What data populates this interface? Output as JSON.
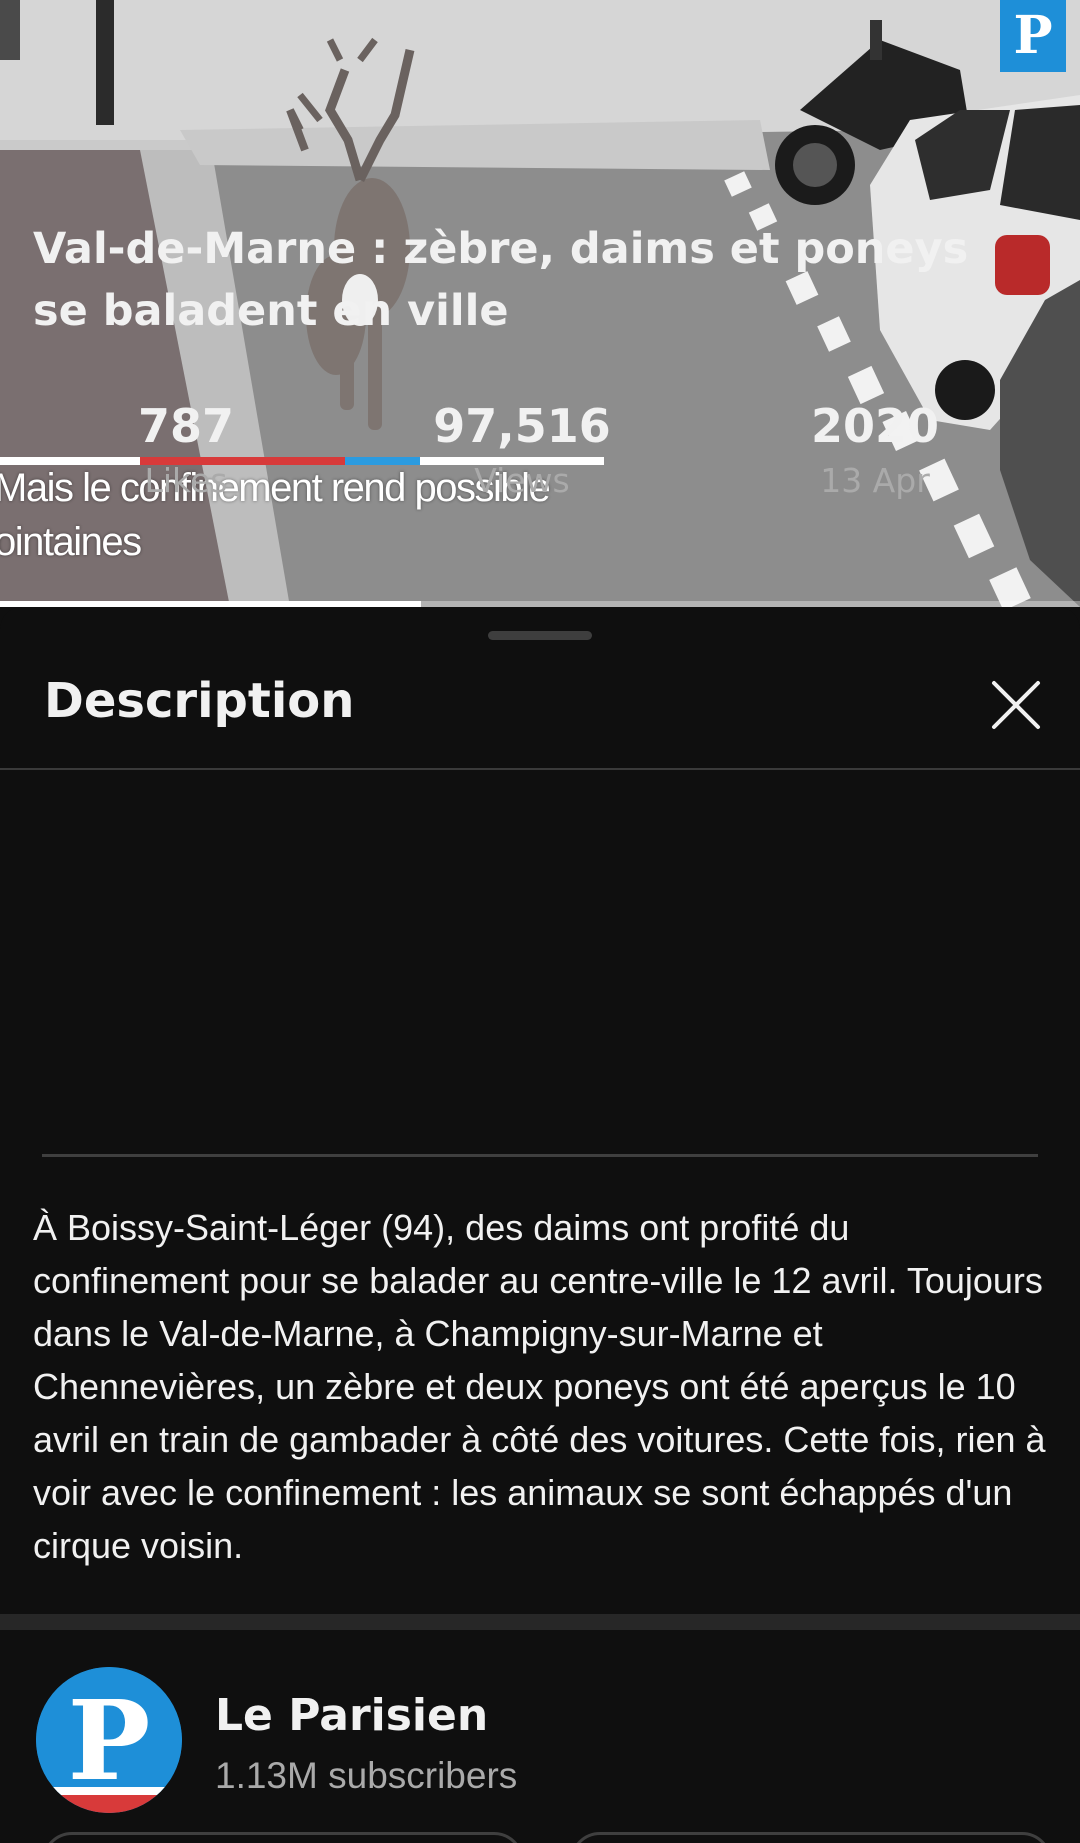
{
  "video": {
    "watermark": "P",
    "subtitle_lines": [
      "Mais le confinement rend possible",
      "ointaines"
    ],
    "progress": 0.39,
    "colors": {
      "bar_white": "#ffffff",
      "bar_red": "#d83a3a",
      "bar_blue": "#2b9be0",
      "logo_blue": "#1e8fd8"
    }
  },
  "sheet": {
    "title": "Description",
    "close_icon": "close-icon"
  },
  "video_info": {
    "title": "Val-de-Marne : zèbre, daims et poneys se baladent en ville",
    "stats": [
      {
        "value": "787",
        "label": "Likes"
      },
      {
        "value": "97,516",
        "label": "Views"
      },
      {
        "value": "2020",
        "label": "13 Apr"
      }
    ],
    "description": "À Boissy-Saint-Léger (94), des daims ont profité du confinement pour se balader au centre-ville le 12 avril. Toujours dans le Val-de-Marne, à Champigny-sur-Marne et Chennevières, un zèbre et deux poneys ont été aperçus le 10 avril en train de gambader à côté des voitures. Cette fois, rien à voir avec le confinement : les animaux se sont échappés d'un cirque voisin."
  },
  "channel": {
    "name": "Le Parisien",
    "subscribers": "1.13M subscribers",
    "avatar_letter": "P"
  },
  "theme": {
    "background": "#0f0f0f",
    "text": "#f1f1f1",
    "secondary_text": "#aaaaaa",
    "divider": "#3a3a3a"
  }
}
